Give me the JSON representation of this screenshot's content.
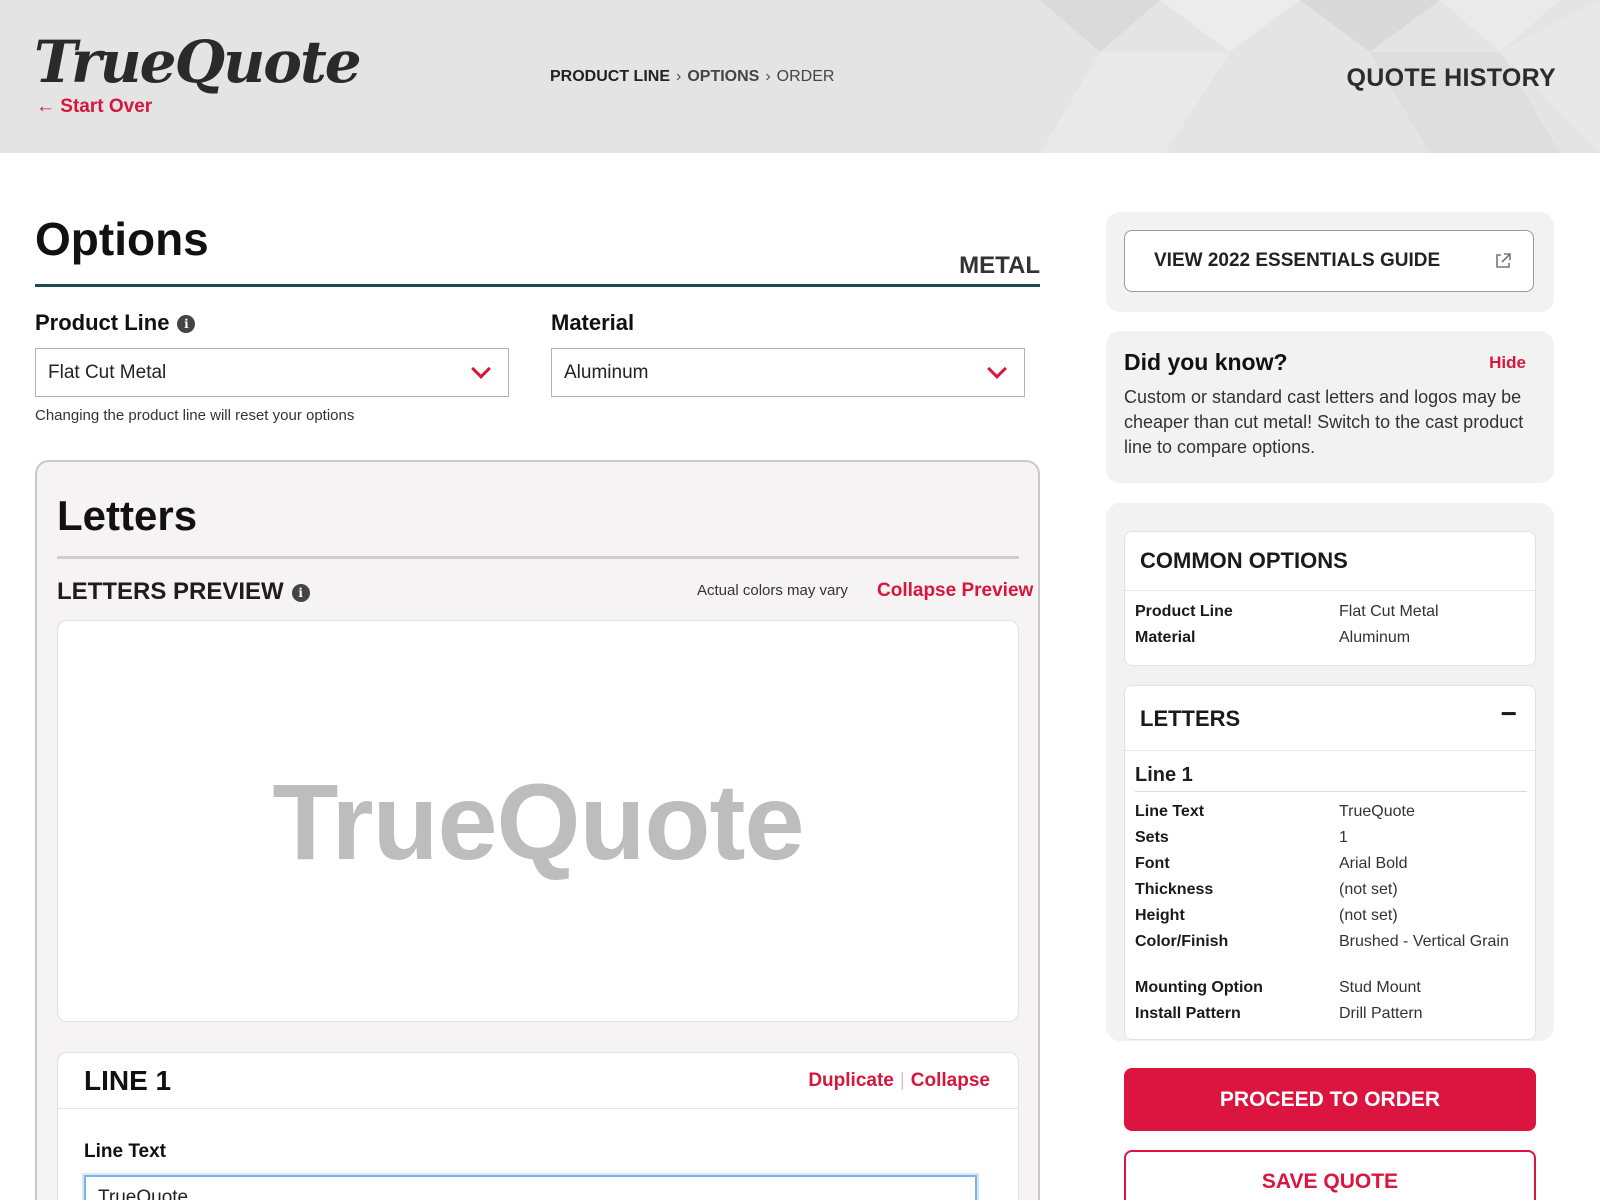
{
  "header": {
    "logo_text": "TrueQuote",
    "start_over": "← Start Over",
    "breadcrumb": [
      "PRODUCT LINE",
      "OPTIONS",
      "ORDER"
    ],
    "quote_history": "QUOTE HISTORY"
  },
  "options": {
    "title": "Options",
    "category_tag": "METAL",
    "product_line_label": "Product Line",
    "product_line_value": "Flat Cut Metal",
    "material_label": "Material",
    "material_value": "Aluminum",
    "helper_text": "Changing the product line will reset your options"
  },
  "letters": {
    "title": "Letters",
    "preview_label": "LETTERS PREVIEW",
    "preview_note": "Actual colors may vary",
    "collapse_preview": "Collapse Preview",
    "preview_text": "TrueQuote",
    "line_card": {
      "title": "LINE 1",
      "duplicate": "Duplicate",
      "collapse": "Collapse",
      "line_text_label": "Line Text",
      "line_text_value": "TrueQuote"
    }
  },
  "sidebar": {
    "guide_button": "VIEW 2022 ESSENTIALS GUIDE",
    "did_you_know": {
      "title": "Did you know?",
      "hide": "Hide",
      "body": "Custom or standard cast letters and logos may be cheaper than cut metal! Switch to the cast product line to compare options."
    },
    "common_options": {
      "title": "COMMON OPTIONS",
      "rows": [
        {
          "key": "Product Line",
          "value": "Flat Cut Metal"
        },
        {
          "key": "Material",
          "value": "Aluminum"
        }
      ]
    },
    "letters_summary": {
      "title": "LETTERS",
      "toggle": "−",
      "line_title": "Line 1",
      "rows": [
        {
          "key": "Line Text",
          "value": "TrueQuote"
        },
        {
          "key": "Sets",
          "value": "1"
        },
        {
          "key": "Font",
          "value": "Arial Bold"
        },
        {
          "key": "Thickness",
          "value": "(not set)"
        },
        {
          "key": "Height",
          "value": "(not set)"
        },
        {
          "key": "Color/Finish",
          "value": "Brushed - Vertical Grain"
        },
        {
          "key": "Mounting Option",
          "value": "Stud Mount"
        },
        {
          "key": "Install Pattern",
          "value": "Drill Pattern"
        }
      ]
    },
    "proceed_button": "PROCEED TO ORDER",
    "save_button": "SAVE QUOTE"
  },
  "colors": {
    "accent_red": "#d6163b",
    "header_bg": "#e4e4e4",
    "rule_teal": "#1d4a4f"
  }
}
